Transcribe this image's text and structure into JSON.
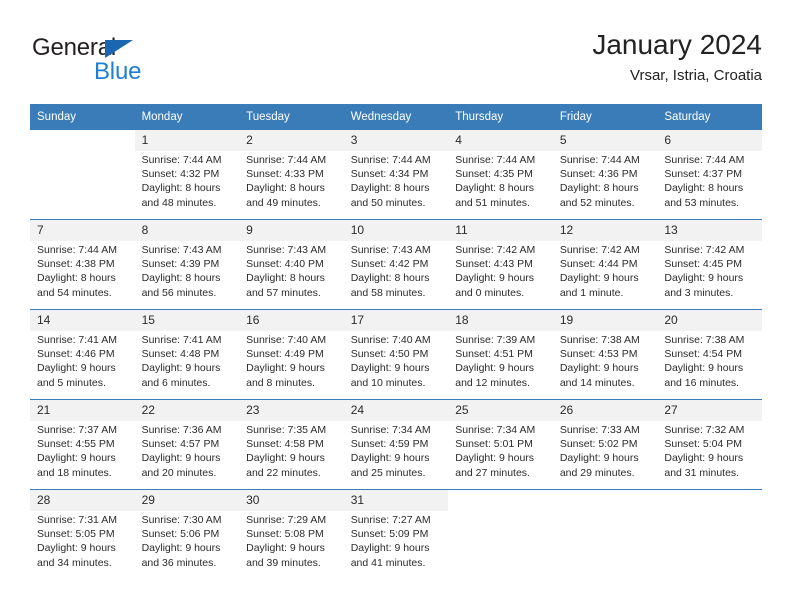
{
  "logo": {
    "word1": "General",
    "word2": "Blue",
    "triangle_color": "#1b66b0",
    "blue_color": "#1f7fd1"
  },
  "header": {
    "title": "January 2024",
    "subtitle": "Vrsar, Istria, Croatia"
  },
  "theme": {
    "header_bg": "#3a7cb8",
    "daynum_bg": "#f2f2f2",
    "text": "#2b2b2b"
  },
  "weekday_headers": [
    "Sunday",
    "Monday",
    "Tuesday",
    "Wednesday",
    "Thursday",
    "Friday",
    "Saturday"
  ],
  "weeks": [
    [
      {
        "day": "",
        "sunrise": "",
        "sunset": "",
        "daylight1": "",
        "daylight2": ""
      },
      {
        "day": "1",
        "sunrise": "Sunrise: 7:44 AM",
        "sunset": "Sunset: 4:32 PM",
        "daylight1": "Daylight: 8 hours",
        "daylight2": "and 48 minutes."
      },
      {
        "day": "2",
        "sunrise": "Sunrise: 7:44 AM",
        "sunset": "Sunset: 4:33 PM",
        "daylight1": "Daylight: 8 hours",
        "daylight2": "and 49 minutes."
      },
      {
        "day": "3",
        "sunrise": "Sunrise: 7:44 AM",
        "sunset": "Sunset: 4:34 PM",
        "daylight1": "Daylight: 8 hours",
        "daylight2": "and 50 minutes."
      },
      {
        "day": "4",
        "sunrise": "Sunrise: 7:44 AM",
        "sunset": "Sunset: 4:35 PM",
        "daylight1": "Daylight: 8 hours",
        "daylight2": "and 51 minutes."
      },
      {
        "day": "5",
        "sunrise": "Sunrise: 7:44 AM",
        "sunset": "Sunset: 4:36 PM",
        "daylight1": "Daylight: 8 hours",
        "daylight2": "and 52 minutes."
      },
      {
        "day": "6",
        "sunrise": "Sunrise: 7:44 AM",
        "sunset": "Sunset: 4:37 PM",
        "daylight1": "Daylight: 8 hours",
        "daylight2": "and 53 minutes."
      }
    ],
    [
      {
        "day": "7",
        "sunrise": "Sunrise: 7:44 AM",
        "sunset": "Sunset: 4:38 PM",
        "daylight1": "Daylight: 8 hours",
        "daylight2": "and 54 minutes."
      },
      {
        "day": "8",
        "sunrise": "Sunrise: 7:43 AM",
        "sunset": "Sunset: 4:39 PM",
        "daylight1": "Daylight: 8 hours",
        "daylight2": "and 56 minutes."
      },
      {
        "day": "9",
        "sunrise": "Sunrise: 7:43 AM",
        "sunset": "Sunset: 4:40 PM",
        "daylight1": "Daylight: 8 hours",
        "daylight2": "and 57 minutes."
      },
      {
        "day": "10",
        "sunrise": "Sunrise: 7:43 AM",
        "sunset": "Sunset: 4:42 PM",
        "daylight1": "Daylight: 8 hours",
        "daylight2": "and 58 minutes."
      },
      {
        "day": "11",
        "sunrise": "Sunrise: 7:42 AM",
        "sunset": "Sunset: 4:43 PM",
        "daylight1": "Daylight: 9 hours",
        "daylight2": "and 0 minutes."
      },
      {
        "day": "12",
        "sunrise": "Sunrise: 7:42 AM",
        "sunset": "Sunset: 4:44 PM",
        "daylight1": "Daylight: 9 hours",
        "daylight2": "and 1 minute."
      },
      {
        "day": "13",
        "sunrise": "Sunrise: 7:42 AM",
        "sunset": "Sunset: 4:45 PM",
        "daylight1": "Daylight: 9 hours",
        "daylight2": "and 3 minutes."
      }
    ],
    [
      {
        "day": "14",
        "sunrise": "Sunrise: 7:41 AM",
        "sunset": "Sunset: 4:46 PM",
        "daylight1": "Daylight: 9 hours",
        "daylight2": "and 5 minutes."
      },
      {
        "day": "15",
        "sunrise": "Sunrise: 7:41 AM",
        "sunset": "Sunset: 4:48 PM",
        "daylight1": "Daylight: 9 hours",
        "daylight2": "and 6 minutes."
      },
      {
        "day": "16",
        "sunrise": "Sunrise: 7:40 AM",
        "sunset": "Sunset: 4:49 PM",
        "daylight1": "Daylight: 9 hours",
        "daylight2": "and 8 minutes."
      },
      {
        "day": "17",
        "sunrise": "Sunrise: 7:40 AM",
        "sunset": "Sunset: 4:50 PM",
        "daylight1": "Daylight: 9 hours",
        "daylight2": "and 10 minutes."
      },
      {
        "day": "18",
        "sunrise": "Sunrise: 7:39 AM",
        "sunset": "Sunset: 4:51 PM",
        "daylight1": "Daylight: 9 hours",
        "daylight2": "and 12 minutes."
      },
      {
        "day": "19",
        "sunrise": "Sunrise: 7:38 AM",
        "sunset": "Sunset: 4:53 PM",
        "daylight1": "Daylight: 9 hours",
        "daylight2": "and 14 minutes."
      },
      {
        "day": "20",
        "sunrise": "Sunrise: 7:38 AM",
        "sunset": "Sunset: 4:54 PM",
        "daylight1": "Daylight: 9 hours",
        "daylight2": "and 16 minutes."
      }
    ],
    [
      {
        "day": "21",
        "sunrise": "Sunrise: 7:37 AM",
        "sunset": "Sunset: 4:55 PM",
        "daylight1": "Daylight: 9 hours",
        "daylight2": "and 18 minutes."
      },
      {
        "day": "22",
        "sunrise": "Sunrise: 7:36 AM",
        "sunset": "Sunset: 4:57 PM",
        "daylight1": "Daylight: 9 hours",
        "daylight2": "and 20 minutes."
      },
      {
        "day": "23",
        "sunrise": "Sunrise: 7:35 AM",
        "sunset": "Sunset: 4:58 PM",
        "daylight1": "Daylight: 9 hours",
        "daylight2": "and 22 minutes."
      },
      {
        "day": "24",
        "sunrise": "Sunrise: 7:34 AM",
        "sunset": "Sunset: 4:59 PM",
        "daylight1": "Daylight: 9 hours",
        "daylight2": "and 25 minutes."
      },
      {
        "day": "25",
        "sunrise": "Sunrise: 7:34 AM",
        "sunset": "Sunset: 5:01 PM",
        "daylight1": "Daylight: 9 hours",
        "daylight2": "and 27 minutes."
      },
      {
        "day": "26",
        "sunrise": "Sunrise: 7:33 AM",
        "sunset": "Sunset: 5:02 PM",
        "daylight1": "Daylight: 9 hours",
        "daylight2": "and 29 minutes."
      },
      {
        "day": "27",
        "sunrise": "Sunrise: 7:32 AM",
        "sunset": "Sunset: 5:04 PM",
        "daylight1": "Daylight: 9 hours",
        "daylight2": "and 31 minutes."
      }
    ],
    [
      {
        "day": "28",
        "sunrise": "Sunrise: 7:31 AM",
        "sunset": "Sunset: 5:05 PM",
        "daylight1": "Daylight: 9 hours",
        "daylight2": "and 34 minutes."
      },
      {
        "day": "29",
        "sunrise": "Sunrise: 7:30 AM",
        "sunset": "Sunset: 5:06 PM",
        "daylight1": "Daylight: 9 hours",
        "daylight2": "and 36 minutes."
      },
      {
        "day": "30",
        "sunrise": "Sunrise: 7:29 AM",
        "sunset": "Sunset: 5:08 PM",
        "daylight1": "Daylight: 9 hours",
        "daylight2": "and 39 minutes."
      },
      {
        "day": "31",
        "sunrise": "Sunrise: 7:27 AM",
        "sunset": "Sunset: 5:09 PM",
        "daylight1": "Daylight: 9 hours",
        "daylight2": "and 41 minutes."
      },
      {
        "day": "",
        "sunrise": "",
        "sunset": "",
        "daylight1": "",
        "daylight2": ""
      },
      {
        "day": "",
        "sunrise": "",
        "sunset": "",
        "daylight1": "",
        "daylight2": ""
      },
      {
        "day": "",
        "sunrise": "",
        "sunset": "",
        "daylight1": "",
        "daylight2": ""
      }
    ]
  ]
}
